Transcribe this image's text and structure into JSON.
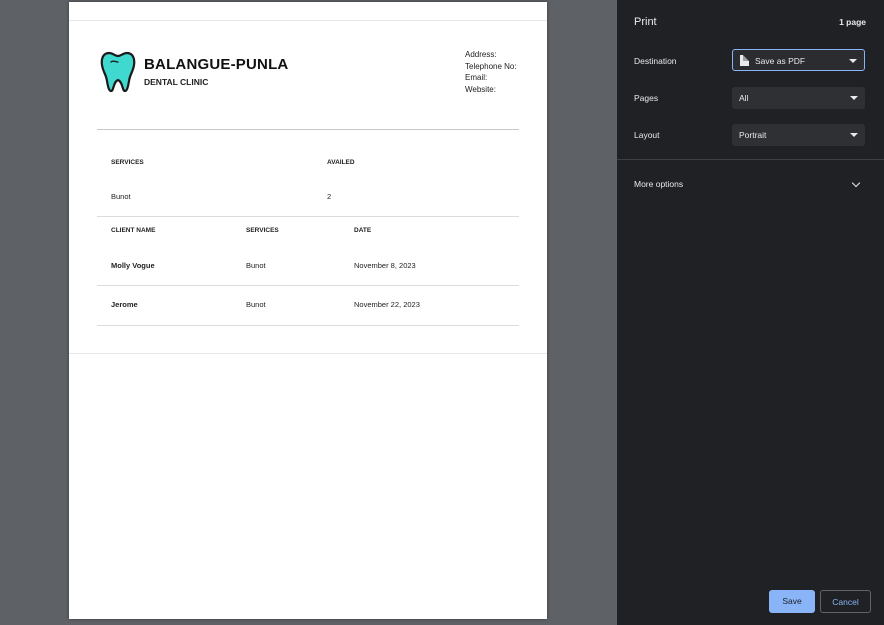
{
  "document": {
    "clinic_name": "BALANGUE-PUNLA",
    "clinic_subtitle": "DENTAL CLINIC",
    "contact_labels": [
      "Address:",
      "Telephone No:",
      "Email:",
      "Website:"
    ],
    "summary_table": {
      "headers": [
        "SERVICES",
        "AVAILED"
      ],
      "rows": [
        [
          "Bunot",
          "2"
        ]
      ]
    },
    "client_table": {
      "headers": [
        "CLIENT NAME",
        "SERVICES",
        "DATE"
      ],
      "rows": [
        [
          "Molly Vogue",
          "Bunot",
          "November 8, 2023"
        ],
        [
          "Jerome",
          "Bunot",
          "November 22, 2023"
        ]
      ]
    },
    "logo_icon": "tooth-icon",
    "accent_color": "#3fd9d0"
  },
  "sidebar": {
    "title": "Print",
    "page_count": "1 page",
    "destination": {
      "label": "Destination",
      "value": "Save as PDF",
      "icon": "document-icon"
    },
    "pages": {
      "label": "Pages",
      "value": "All"
    },
    "layout": {
      "label": "Layout",
      "value": "Portrait"
    },
    "more_options": "More options",
    "save_label": "Save",
    "cancel_label": "Cancel",
    "accent_color": "#8ab4f8",
    "background_color": "#202124"
  }
}
